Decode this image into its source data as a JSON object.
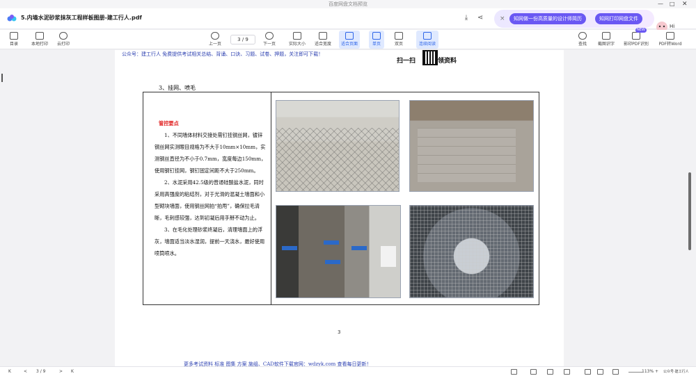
{
  "window": {
    "title": "百度网盘文档预览",
    "file_name": "5.内墙水泥砂浆抹灰工程样板图册-建工行人.pdf",
    "minimize": "—",
    "maximize": "□",
    "close": "✕"
  },
  "promo": {
    "close": "×",
    "pill1": "知网做一份高质量的设计师简历",
    "pill2": "知网打印网盘文件",
    "greeting": "Hi"
  },
  "toolbar": {
    "left": [
      {
        "label": "目录",
        "icon": "toc-icon"
      },
      {
        "label": "本地打印",
        "icon": "print-icon"
      },
      {
        "label": "云打印",
        "icon": "cloud-print-icon"
      }
    ],
    "prev": "上一页",
    "next": "下一页",
    "page_indicator": "3 / 9",
    "center": [
      {
        "label": "实际大小"
      },
      {
        "label": "适合宽度"
      },
      {
        "label": "适合页面"
      },
      {
        "label": "单页"
      },
      {
        "label": "双页"
      },
      {
        "label": "连续阅读"
      }
    ],
    "right": [
      {
        "label": "查找"
      },
      {
        "label": "截图识字"
      },
      {
        "label": "影印PDF识别"
      },
      {
        "label": "PDF转Word"
      }
    ],
    "new_badge": "NEW"
  },
  "page": {
    "header_text": "公众号：建工行人 免费提供考试相关总结、背诵、口诀、习题、试卷、押题，关注即可下载！",
    "qr_label_left": "扫一扫",
    "qr_label_right": "领资料",
    "section": "3、挂网、喷毛",
    "control_title": "管控要点",
    "paragraphs": [
      "1、不同墙体材料交接处需钉挂钢丝网，镀锌钢丝网实测眼目规格为不大于10mm×10mm，实测钢丝直径为不小于0.7mm，宽度每边150mm，使用钢钉挂网，钢钉固定间距不大于250mm。",
      "2、水泥采用42.5级的普通硅酸盐水泥，同时采用高强度的粘结剂，对于光滑的混凝土墙面和小型砌块墙面，使用钢丝网拍“拍甩”，确保拉毛清晰，毛刺感较强，达到初凝后用手掰不动为止。",
      "3、在毛化处理砂浆终凝后，清理墙面上的浮灰，墙面适当淡水湿润，提前一天浇水，最好使用喷筒喷水。"
    ],
    "page_number": "3",
    "footer_text": "更多考试资料 标准 图集 方案 施组、CAD软件下载官网：wdzyk.com 查看每日更新！"
  },
  "statusbar": {
    "first": "K",
    "prev": "<",
    "page": "3 / 9",
    "next": ">",
    "last": "K",
    "zoom": "113%",
    "plus": "+",
    "watermark": "公众号·建工行人"
  }
}
